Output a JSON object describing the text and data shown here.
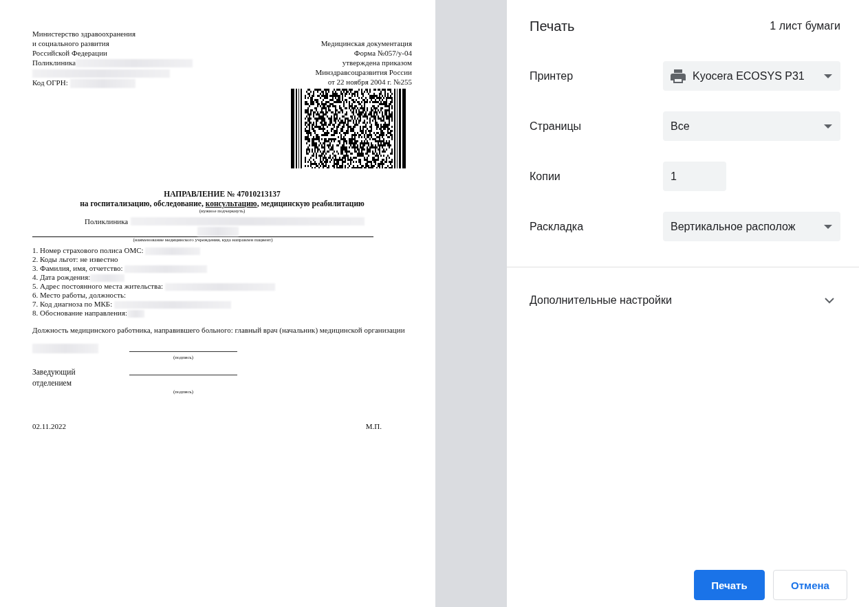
{
  "document": {
    "header_left": [
      "Министерство здравоохранения",
      "и социального развития",
      "Российской Федерации",
      "Поликлиника"
    ],
    "ogrn_label": "Код ОГРН:",
    "header_right": [
      "Медицинская документация",
      "Форма №057/у-04",
      "утверждена приказом",
      "Минздравсоцразвития России",
      "от 22 ноября 2004 г. №255"
    ],
    "title": "НАПРАВЛЕНИЕ № 47010213137",
    "subtitle": [
      {
        "text": "на госпитализацию, обследование, ",
        "underlined": false
      },
      {
        "text": "консультацию",
        "underlined": true
      },
      {
        "text": ", медицинскую реабилитацию",
        "underlined": false
      }
    ],
    "subtitle_note": "(нужное подчеркнуть)",
    "institution_label": "Поликлиника",
    "institution_note": "(наименование медицинского учреждения, куда направлен пациент)",
    "fields": [
      {
        "text": "1. Номер страхового полиса ОМС: ",
        "redacted": true
      },
      {
        "text": "2. Коды льгот: не известно",
        "redacted": false
      },
      {
        "text": "3. Фамилия, имя, отчетство: ",
        "redacted": true
      },
      {
        "text": "4. Дата рождения:",
        "redacted": true
      },
      {
        "text": "5. Адрес постоянного места жительства: ",
        "redacted": true
      },
      {
        "text": "6. Место работы, должность:",
        "redacted": false
      },
      {
        "text": "7. Код диагноза по МКБ: ",
        "redacted": true
      },
      {
        "text": "8. Обоснование направления:",
        "redacted": true
      }
    ],
    "position_text": "Должность медицинского работника, направившего больного: главный врач (начальник) медицинской организации",
    "signatures": [
      {
        "redacted": true,
        "note": "(подпись)"
      },
      {
        "label": "Заведующий отделением",
        "redacted": false,
        "note": "(подпись)"
      }
    ],
    "date": "02.11.2022",
    "stamp": "М.П."
  },
  "settings": {
    "title": "Печать",
    "sheets": "1 лист бумаги",
    "rows": [
      {
        "kind": "printer",
        "label": "Принтер",
        "value": "Kyocera ECOSYS P31"
      },
      {
        "kind": "select",
        "label": "Страницы",
        "value": "Все"
      },
      {
        "kind": "number",
        "label": "Копии",
        "value": "1"
      },
      {
        "kind": "select",
        "label": "Раскладка",
        "value": "Вертикальное располож"
      }
    ],
    "more": {
      "label": "Дополнительные настройки",
      "expanded": false
    },
    "buttons": [
      {
        "label": "Печать",
        "primary": true
      },
      {
        "label": "Отмена",
        "primary": false
      }
    ]
  }
}
